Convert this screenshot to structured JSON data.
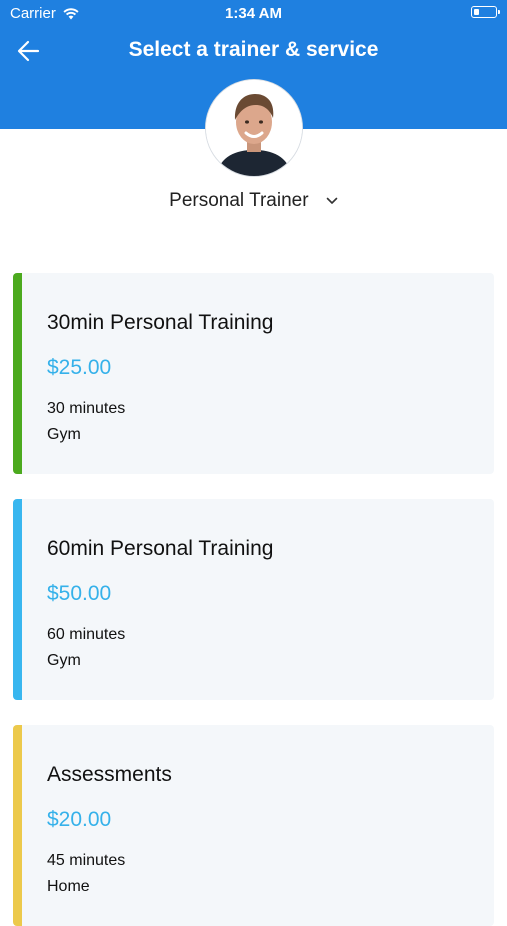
{
  "status_bar": {
    "carrier": "Carrier",
    "time": "1:34 AM",
    "battery_level": 0.25
  },
  "header": {
    "title": "Select a trainer & service",
    "back_icon": "arrow-left-icon"
  },
  "trainer": {
    "role": "Personal Trainer",
    "dropdown_icon": "chevron-down-icon"
  },
  "colors": {
    "header": "#1f80e0",
    "price": "#35b1ea"
  },
  "services": [
    {
      "name": "30min Personal Training",
      "price": "$25.00",
      "duration": "30 minutes",
      "location": "Gym",
      "accent": "#4caa1e"
    },
    {
      "name": "60min Personal Training",
      "price": "$50.00",
      "duration": "60 minutes",
      "location": "Gym",
      "accent": "#38b6ef"
    },
    {
      "name": "Assessments",
      "price": "$20.00",
      "duration": "45 minutes",
      "location": "Home",
      "accent": "#ecc94b"
    }
  ]
}
